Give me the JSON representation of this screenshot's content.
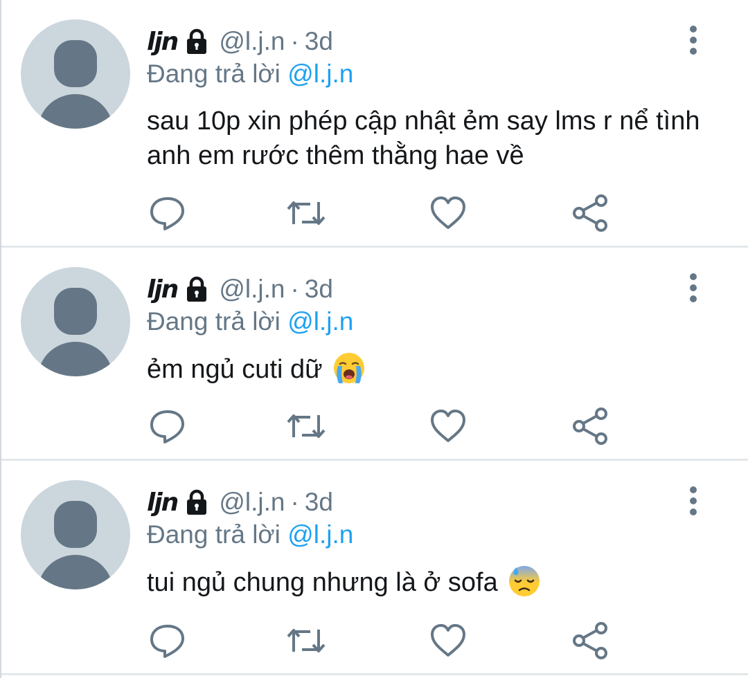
{
  "colors": {
    "text": "#14171a",
    "secondary": "#657786",
    "link": "#1da1f2",
    "icon": "#657786",
    "avatar_bg": "#ccd6dd",
    "avatar_fg": "#657786"
  },
  "tweets": [
    {
      "name": "ljn",
      "handle": "@l.j.n",
      "separator": "·",
      "time": "3d",
      "reply_prefix": "Đang trả lời",
      "reply_to": "@l.j.n",
      "text": "sau 10p xin phép cập nhật ẻm say lms r nể tình anh em rước thêm thằng hae về",
      "emoji": ""
    },
    {
      "name": "ljn",
      "handle": "@l.j.n",
      "separator": "·",
      "time": "3d",
      "reply_prefix": "Đang trả lời",
      "reply_to": "@l.j.n",
      "text": "ẻm ngủ cuti dữ",
      "emoji": "loudly-crying-face"
    },
    {
      "name": "ljn",
      "handle": "@l.j.n",
      "separator": "·",
      "time": "3d",
      "reply_prefix": "Đang trả lời",
      "reply_to": "@l.j.n",
      "text": "tui ngủ chung nhưng là ở sofa",
      "emoji": "downcast-face-with-sweat"
    }
  ],
  "icons": {
    "lock": "lock-icon",
    "menu": "more-vertical-icon",
    "reply": "reply-icon",
    "retweet": "retweet-icon",
    "like": "heart-icon",
    "share": "share-icon"
  }
}
